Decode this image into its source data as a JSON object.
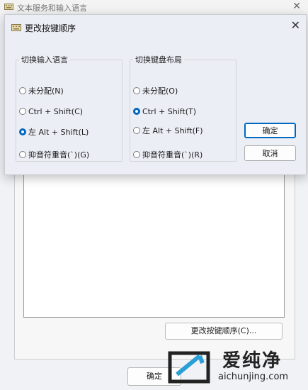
{
  "background_window": {
    "title": "文本服务和输入语言",
    "close_glyph": "✕",
    "change_key_sequence_button": "更改按键顺序(C)...",
    "ok_button": "确定"
  },
  "dialog": {
    "title": "更改按键顺序",
    "close_glyph": "✕",
    "language_group": {
      "legend": "切换输入语言",
      "options": [
        {
          "label": "未分配(N)",
          "checked": false
        },
        {
          "label": "Ctrl + Shift(C)",
          "checked": false
        },
        {
          "label": "左 Alt + Shift(L)",
          "checked": true
        },
        {
          "label": "抑音符重音(`)(G)",
          "checked": false
        }
      ]
    },
    "layout_group": {
      "legend": "切换键盘布局",
      "options": [
        {
          "label": "未分配(O)",
          "checked": false
        },
        {
          "label": "Ctrl + Shift(T)",
          "checked": true
        },
        {
          "label": "左 Alt + Shift(F)",
          "checked": false
        },
        {
          "label": "抑音符重音(`)(R)",
          "checked": false
        }
      ]
    },
    "ok_button": "确定",
    "cancel_button": "取消"
  },
  "watermark": {
    "brand": "爱纯净",
    "url": "aichunjing.com"
  },
  "colors": {
    "accent": "#0067c0"
  }
}
